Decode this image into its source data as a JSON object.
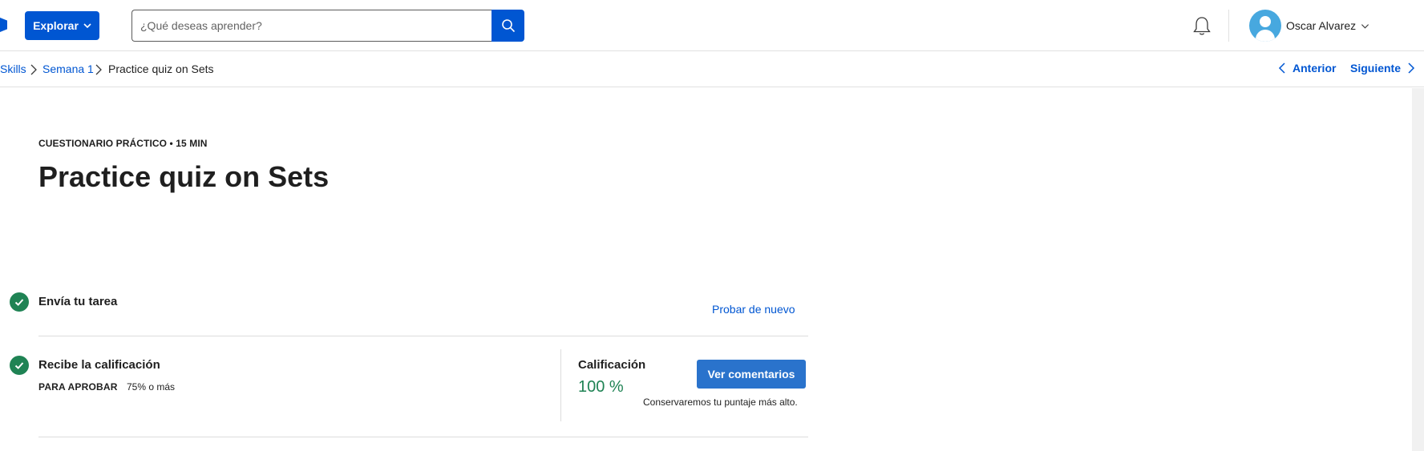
{
  "header": {
    "explore_label": "Explorar",
    "search_placeholder": "¿Qué deseas aprender?",
    "user_name": "Oscar Alvarez",
    "icons": {
      "logo": "logo-fragment",
      "explore_chevron": "chevron-down-icon",
      "search": "search-icon",
      "notifications": "bell-icon",
      "avatar": "user-avatar-icon",
      "user_chevron": "chevron-down-icon"
    }
  },
  "breadcrumb": {
    "items": [
      "Skills",
      "Semana 1",
      "Practice quiz on Sets"
    ],
    "prev_label": "Anterior",
    "next_label": "Siguiente"
  },
  "content": {
    "meta": "CUESTIONARIO PRÁCTICO • 15 MIN",
    "title": "Practice quiz on Sets",
    "step1_title": "Envía tu tarea",
    "retry_label": "Probar de nuevo",
    "step2_title": "Recibe la calificación",
    "pass_label": "PARA APROBAR",
    "pass_value": "75% o más",
    "grade_label": "Calificación",
    "grade_value": "100 %",
    "feedback_button": "Ver comentarios",
    "keep_note": "Conservaremos tu puntaje más alto."
  },
  "colors": {
    "brand_blue": "#0056d2",
    "button_blue": "#2a73cc",
    "success_green": "#1f8354",
    "avatar_blue": "#47a8df"
  }
}
